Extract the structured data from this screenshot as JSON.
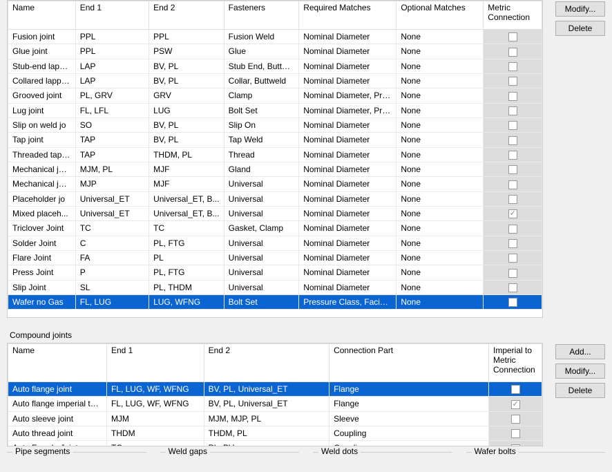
{
  "upper_table": {
    "headers": {
      "name": "Name",
      "end1": "End 1",
      "end2": "End 2",
      "fasteners": "Fasteners",
      "required": "Required Matches",
      "optional": "Optional Matches",
      "metric": "Metric Connection"
    },
    "rows": [
      {
        "name": "Fusion joint",
        "end1": "PPL",
        "end2": "PPL",
        "fasteners": "Fusion Weld",
        "required": "Nominal Diameter",
        "optional": "None",
        "metric": false,
        "selected": false
      },
      {
        "name": "Glue joint",
        "end1": "PPL",
        "end2": "PSW",
        "fasteners": "Glue",
        "required": "Nominal Diameter",
        "optional": "None",
        "metric": false,
        "selected": false
      },
      {
        "name": "Stub-end lapp...",
        "end1": "LAP",
        "end2": "BV, PL",
        "fasteners": "Stub End, Buttweld",
        "required": "Nominal Diameter",
        "optional": "None",
        "metric": false,
        "selected": false
      },
      {
        "name": "Collared lappe...",
        "end1": "LAP",
        "end2": "BV, PL",
        "fasteners": "Collar, Buttweld",
        "required": "Nominal Diameter",
        "optional": "None",
        "metric": false,
        "selected": false
      },
      {
        "name": "Grooved joint",
        "end1": "PL, GRV",
        "end2": "GRV",
        "fasteners": "Clamp",
        "required": "Nominal Diameter, Press...",
        "optional": "None",
        "metric": false,
        "selected": false
      },
      {
        "name": "Lug joint",
        "end1": "FL, LFL",
        "end2": "LUG",
        "fasteners": "Bolt Set",
        "required": "Nominal Diameter, Press...",
        "optional": "None",
        "metric": false,
        "selected": false
      },
      {
        "name": "Slip on weld jo",
        "end1": "SO",
        "end2": "BV, PL",
        "fasteners": "Slip On",
        "required": "Nominal Diameter",
        "optional": "None",
        "metric": false,
        "selected": false
      },
      {
        "name": "Tap joint",
        "end1": "TAP",
        "end2": "BV, PL",
        "fasteners": "Tap Weld",
        "required": "Nominal Diameter",
        "optional": "None",
        "metric": false,
        "selected": false
      },
      {
        "name": "Threaded tap ...",
        "end1": "TAP",
        "end2": "THDM, PL",
        "fasteners": "Thread",
        "required": "Nominal Diameter",
        "optional": "None",
        "metric": false,
        "selected": false
      },
      {
        "name": "Mechanical joint",
        "end1": "MJM, PL",
        "end2": "MJF",
        "fasteners": "Gland",
        "required": "Nominal Diameter",
        "optional": "None",
        "metric": false,
        "selected": false
      },
      {
        "name": "Mechanical joi...",
        "end1": "MJP",
        "end2": "MJF",
        "fasteners": "Universal",
        "required": "Nominal Diameter",
        "optional": "None",
        "metric": false,
        "selected": false
      },
      {
        "name": "Placeholder jo",
        "end1": "Universal_ET",
        "end2": "Universal_ET, B...",
        "fasteners": "Universal",
        "required": "Nominal Diameter",
        "optional": "None",
        "metric": false,
        "selected": false
      },
      {
        "name": "Mixed placeh...",
        "end1": "Universal_ET",
        "end2": "Universal_ET, B...",
        "fasteners": "Universal",
        "required": "Nominal Diameter",
        "optional": "None",
        "metric": true,
        "selected": false
      },
      {
        "name": "Triclover Joint",
        "end1": "TC",
        "end2": "TC",
        "fasteners": "Gasket, Clamp",
        "required": "Nominal Diameter",
        "optional": "None",
        "metric": false,
        "selected": false
      },
      {
        "name": "Solder Joint",
        "end1": "C",
        "end2": "PL, FTG",
        "fasteners": "Universal",
        "required": "Nominal Diameter",
        "optional": "None",
        "metric": false,
        "selected": false
      },
      {
        "name": "Flare Joint",
        "end1": "FA",
        "end2": "PL",
        "fasteners": "Universal",
        "required": "Nominal Diameter",
        "optional": "None",
        "metric": false,
        "selected": false
      },
      {
        "name": "Press Joint",
        "end1": "P",
        "end2": "PL, FTG",
        "fasteners": "Universal",
        "required": "Nominal Diameter",
        "optional": "None",
        "metric": false,
        "selected": false
      },
      {
        "name": "Slip Joint",
        "end1": "SL",
        "end2": "PL, THDM",
        "fasteners": "Universal",
        "required": "Nominal Diameter",
        "optional": "None",
        "metric": false,
        "selected": false
      },
      {
        "name": "Wafer no Gas",
        "end1": "FL, LUG",
        "end2": "LUG, WFNG",
        "fasteners": "Bolt Set",
        "required": "Pressure Class, Facing, ...",
        "optional": "None",
        "metric": false,
        "selected": true
      }
    ]
  },
  "compound_label": "Compound joints",
  "compound_table": {
    "headers": {
      "name": "Name",
      "end1": "End 1",
      "end2": "End 2",
      "part": "Connection Part",
      "metric": "Imperial to Metric Connection"
    },
    "rows": [
      {
        "name": "Auto flange joint",
        "end1": "FL, LUG, WF, WFNG",
        "end2": "BV, PL, Universal_ET",
        "part": "Flange",
        "metric": false,
        "selected": true
      },
      {
        "name": "Auto flange imperial to ...",
        "end1": "FL, LUG, WF, WFNG",
        "end2": "BV, PL, Universal_ET",
        "part": "Flange",
        "metric": true,
        "selected": false
      },
      {
        "name": "Auto sleeve joint",
        "end1": "MJM",
        "end2": "MJM, MJP, PL",
        "part": "Sleeve",
        "metric": false,
        "selected": false
      },
      {
        "name": "Auto thread joint",
        "end1": "THDM",
        "end2": "THDM, PL",
        "part": "Coupling",
        "metric": false,
        "selected": false
      },
      {
        "name": "Auto Ferrule Joint",
        "end1": "TC",
        "end2": "PL, BV",
        "part": "Coupling",
        "metric": false,
        "selected": false
      }
    ]
  },
  "buttons_upper": {
    "modify": "Modify...",
    "delete": "Delete"
  },
  "buttons_lower": {
    "add": "Add...",
    "modify": "Modify...",
    "delete": "Delete"
  },
  "bottom_groups": {
    "pipe_segments": "Pipe segments",
    "weld_gaps": "Weld gaps",
    "weld_dots": "Weld dots",
    "wafer_bolts": "Wafer bolts"
  }
}
